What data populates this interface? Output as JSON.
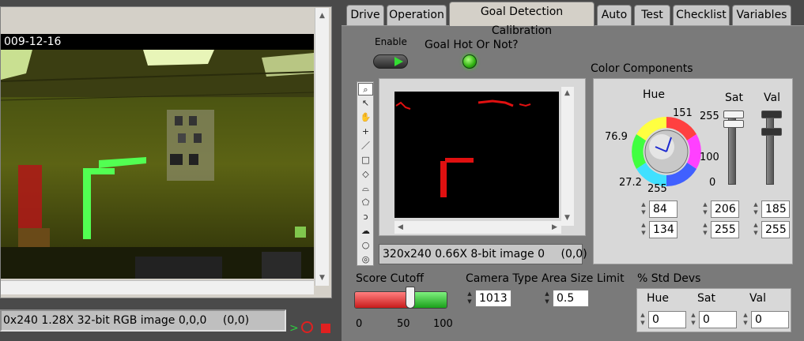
{
  "left_view": {
    "date_text": "009-12-16",
    "status_text": "0x240 1.28X 32-bit RGB image 0,0,0",
    "status_coord": "(0,0)"
  },
  "tabs": [
    {
      "label": "Drive"
    },
    {
      "label": "Operation"
    },
    {
      "label": "Goal Detection Calibration",
      "active": true
    },
    {
      "label": "Auto"
    },
    {
      "label": "Test"
    },
    {
      "label": "Checklist"
    },
    {
      "label": "Variables"
    }
  ],
  "calibration": {
    "enable_label": "Enable",
    "goal_label": "Goal Hot Or Not?",
    "goal_led_color": "#39d21a",
    "processed_status": "320x240 0.66X 8-bit image 0",
    "processed_coord": "(0,0)",
    "color_components_label": "Color Components",
    "hue": {
      "label": "Hue",
      "scale": [
        "151",
        "76.9",
        "27.2",
        "255"
      ],
      "min": "84",
      "max": "134"
    },
    "sat": {
      "label": "Sat",
      "scale": [
        "255",
        "100",
        "0"
      ],
      "min": "206",
      "max": "255",
      "lower_level": 0.808,
      "upper_level": 1.0
    },
    "val": {
      "label": "Val",
      "min": "185",
      "max": "255",
      "lower_level": 0.725,
      "upper_level": 1.0
    },
    "score_cutoff": {
      "label": "Score Cutoff",
      "value": 60,
      "ticks": [
        "0",
        "50",
        "100"
      ]
    },
    "camera_type": {
      "label": "Camera Type",
      "value": "1013"
    },
    "area_limit": {
      "label": "Area Size Limit",
      "value": "0.5"
    },
    "std_devs": {
      "label": "% Std Devs",
      "hue_label": "Hue",
      "sat_label": "Sat",
      "val_label": "Val",
      "hue": "0",
      "sat": "0",
      "val": "0"
    }
  }
}
